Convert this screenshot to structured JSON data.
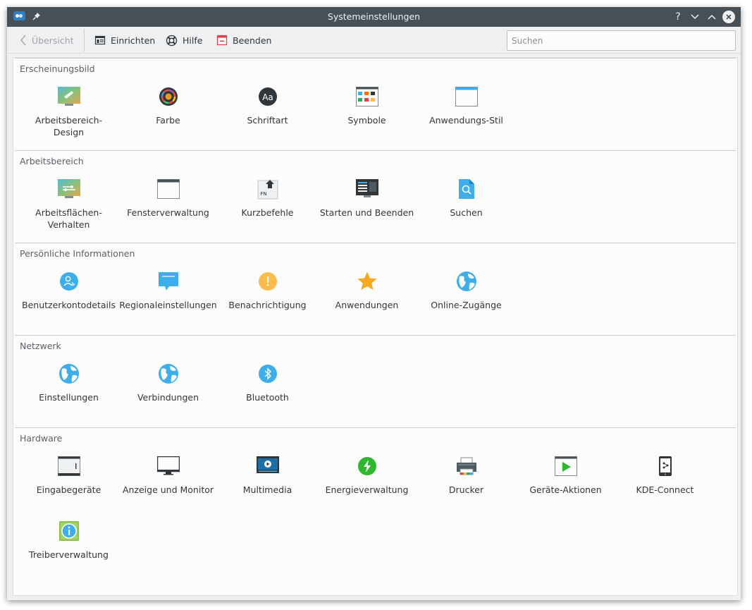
{
  "window": {
    "title": "Systemeinstellungen"
  },
  "titlebar": {
    "help_glyph": "?",
    "minimize_glyph": "⌄",
    "maximize_glyph": "⌃"
  },
  "toolbar": {
    "overview_label": "Übersicht",
    "configure_label": "Einrichten",
    "help_label": "Hilfe",
    "quit_label": "Beenden"
  },
  "search": {
    "placeholder": "Suchen",
    "value": ""
  },
  "categories": [
    {
      "title": "Erscheinungsbild",
      "modules": [
        {
          "label": "Arbeitsbereich-Design",
          "icon": "workspace-theme-icon"
        },
        {
          "label": "Farbe",
          "icon": "color-icon"
        },
        {
          "label": "Schriftart",
          "icon": "font-icon"
        },
        {
          "label": "Symbole",
          "icon": "icons-icon"
        },
        {
          "label": "Anwendungs-Stil",
          "icon": "app-style-icon"
        }
      ]
    },
    {
      "title": "Arbeitsbereich",
      "modules": [
        {
          "label": "Arbeitsflächen-Verhalten",
          "icon": "desktop-behavior-icon"
        },
        {
          "label": "Fensterverwaltung",
          "icon": "window-management-icon"
        },
        {
          "label": "Kurzbefehle",
          "icon": "shortcuts-icon"
        },
        {
          "label": "Starten und Beenden",
          "icon": "startup-shutdown-icon"
        },
        {
          "label": "Suchen",
          "icon": "search-file-icon"
        }
      ]
    },
    {
      "title": "Persönliche Informationen",
      "modules": [
        {
          "label": "Benutzerkontodetails",
          "icon": "user-account-icon"
        },
        {
          "label": "Regionaleinstellungen",
          "icon": "regional-settings-icon"
        },
        {
          "label": "Benachrichtigung",
          "icon": "notification-icon"
        },
        {
          "label": "Anwendungen",
          "icon": "applications-star-icon"
        },
        {
          "label": "Online-Zugänge",
          "icon": "online-accounts-icon"
        }
      ]
    },
    {
      "title": "Netzwerk",
      "modules": [
        {
          "label": "Einstellungen",
          "icon": "network-globe-icon"
        },
        {
          "label": "Verbindungen",
          "icon": "connections-globe-icon"
        },
        {
          "label": "Bluetooth",
          "icon": "bluetooth-icon"
        }
      ]
    },
    {
      "title": "Hardware",
      "modules": [
        {
          "label": "Eingabegeräte",
          "icon": "input-devices-icon"
        },
        {
          "label": "Anzeige und Monitor",
          "icon": "monitor-icon"
        },
        {
          "label": "Multimedia",
          "icon": "multimedia-icon"
        },
        {
          "label": "Energieverwaltung",
          "icon": "power-management-icon"
        },
        {
          "label": "Drucker",
          "icon": "printer-icon"
        },
        {
          "label": "Geräte-Aktionen",
          "icon": "device-actions-icon"
        },
        {
          "label": "KDE-Connect",
          "icon": "kde-connect-icon"
        },
        {
          "label": "Treiberverwaltung",
          "icon": "driver-manager-icon"
        }
      ]
    }
  ],
  "colors": {
    "titlebar": "#475057",
    "window_bg": "#eff0f1",
    "content_bg": "#fcfcfc",
    "accent_blue": "#2b9fe6",
    "warning_orange": "#f7a823",
    "power_green": "#2eb82e",
    "quit_red": "#da4453"
  }
}
